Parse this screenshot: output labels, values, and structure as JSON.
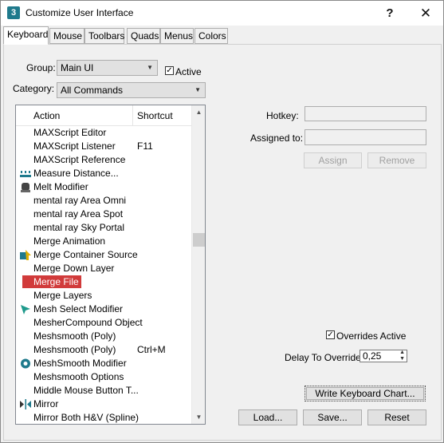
{
  "window": {
    "title": "Customize User Interface",
    "app_icon": "3",
    "help": "?",
    "close": "✕"
  },
  "tabs": [
    {
      "label": "Keyboard",
      "active": true
    },
    {
      "label": "Mouse"
    },
    {
      "label": "Toolbars"
    },
    {
      "label": "Quads"
    },
    {
      "label": "Menus"
    },
    {
      "label": "Colors"
    }
  ],
  "group": {
    "label": "Group:",
    "value": "Main UI"
  },
  "active": {
    "label": "Active",
    "checked": true
  },
  "category": {
    "label": "Category:",
    "value": "All Commands"
  },
  "list": {
    "headers": {
      "action": "Action",
      "shortcut": "Shortcut"
    },
    "rows": [
      {
        "action": "MAXScript Editor",
        "shortcut": "",
        "icon": ""
      },
      {
        "action": "MAXScript Listener",
        "shortcut": "F11",
        "icon": ""
      },
      {
        "action": "MAXScript Reference",
        "shortcut": "",
        "icon": ""
      },
      {
        "action": "Measure Distance...",
        "shortcut": "",
        "icon": "measure-distance-icon"
      },
      {
        "action": "Melt Modifier",
        "shortcut": "",
        "icon": "melt-modifier-icon"
      },
      {
        "action": "mental ray Area Omni",
        "shortcut": "",
        "icon": ""
      },
      {
        "action": "mental ray Area Spot",
        "shortcut": "",
        "icon": ""
      },
      {
        "action": "mental ray Sky Portal",
        "shortcut": "",
        "icon": ""
      },
      {
        "action": "Merge Animation",
        "shortcut": "",
        "icon": ""
      },
      {
        "action": "Merge Container Source",
        "shortcut": "",
        "icon": "merge-container-icon"
      },
      {
        "action": "Merge Down Layer",
        "shortcut": "",
        "icon": ""
      },
      {
        "action": "Merge File",
        "shortcut": "",
        "icon": "",
        "selected": true
      },
      {
        "action": "Merge Layers",
        "shortcut": "",
        "icon": ""
      },
      {
        "action": "Mesh Select Modifier",
        "shortcut": "",
        "icon": "mesh-select-icon"
      },
      {
        "action": "MesherCompound Object",
        "shortcut": "",
        "icon": ""
      },
      {
        "action": "Meshsmooth (Poly)",
        "shortcut": "",
        "icon": ""
      },
      {
        "action": "Meshsmooth (Poly)",
        "shortcut": "Ctrl+M",
        "icon": ""
      },
      {
        "action": "MeshSmooth Modifier",
        "shortcut": "",
        "icon": "meshsmooth-modifier-icon"
      },
      {
        "action": "Meshsmooth Options",
        "shortcut": "",
        "icon": ""
      },
      {
        "action": "Middle Mouse Button T...",
        "shortcut": "",
        "icon": ""
      },
      {
        "action": "Mirror",
        "shortcut": "",
        "icon": "mirror-icon"
      },
      {
        "action": "Mirror Both H&V (Spline)",
        "shortcut": "",
        "icon": ""
      }
    ]
  },
  "hotkey": {
    "label": "Hotkey:",
    "value": ""
  },
  "assigned_to": {
    "label": "Assigned to:",
    "value": ""
  },
  "buttons": {
    "assign": "Assign",
    "remove": "Remove",
    "write_chart": "Write Keyboard Chart...",
    "load": "Load...",
    "save": "Save...",
    "reset": "Reset"
  },
  "overrides_active": {
    "label": "Overrides Active",
    "checked": true
  },
  "delay": {
    "label": "Delay To Override:",
    "value": "0,25"
  },
  "colors": {
    "selection": "#d13b3b",
    "icon_teal": "#1f7a8c"
  }
}
